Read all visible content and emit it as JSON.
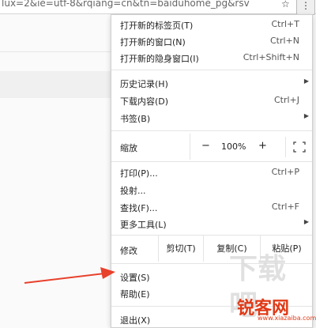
{
  "browser": {
    "url_fragment": "lux=2&ie=utf-8&rqiang=cn&tn=baiduhome_pg&rsv"
  },
  "menu": {
    "new_tab": {
      "label": "打开新的标签页(T)",
      "shortcut": "Ctrl+T"
    },
    "new_window": {
      "label": "打开新的窗口(N)",
      "shortcut": "Ctrl+N"
    },
    "new_incognito": {
      "label": "打开新的隐身窗口(I)",
      "shortcut": "Ctrl+Shift+N"
    },
    "history": {
      "label": "历史记录(H)"
    },
    "downloads": {
      "label": "下载内容(D)",
      "shortcut": "Ctrl+J"
    },
    "bookmarks": {
      "label": "书签(B)"
    },
    "zoom": {
      "label": "缩放",
      "minus": "−",
      "value": "100%",
      "plus": "+"
    },
    "print": {
      "label": "打印(P)...",
      "shortcut": "Ctrl+P"
    },
    "cast": {
      "label": "投射..."
    },
    "find": {
      "label": "查找(F)...",
      "shortcut": "Ctrl+F"
    },
    "more_tools": {
      "label": "更多工具(L)"
    },
    "edit": {
      "label": "修改",
      "cut": "剪切(T)",
      "copy": "复制(C)",
      "paste": "粘贴(P)"
    },
    "settings": {
      "label": "设置(S)"
    },
    "help": {
      "label": "帮助(E)"
    },
    "exit": {
      "label": "退出(X)"
    }
  },
  "watermark": {
    "logo_text": "下载吧",
    "brand": "锐客网",
    "url": "www.xiazaiba.com"
  },
  "colors": {
    "annotation_arrow": "#e8412c",
    "watermark_red": "#e03a17"
  }
}
